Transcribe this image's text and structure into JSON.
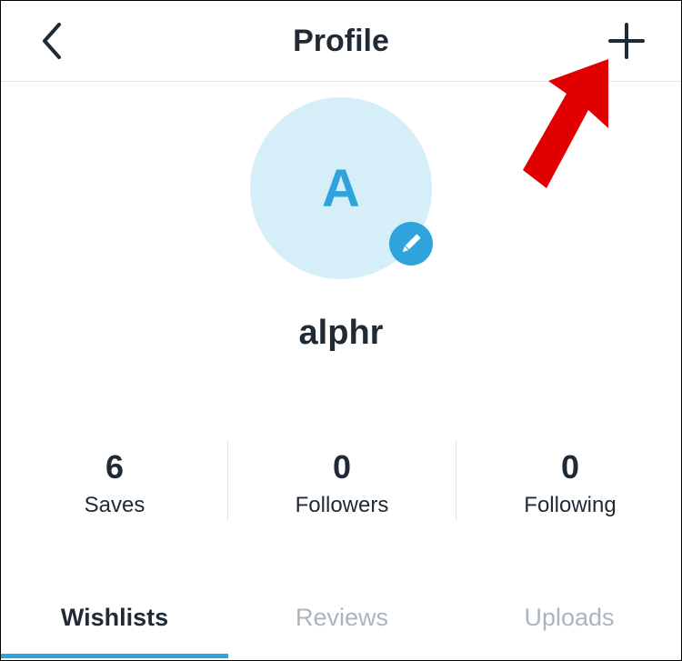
{
  "header": {
    "title": "Profile",
    "back_icon": "chevron-left-icon",
    "add_icon": "plus-icon"
  },
  "profile": {
    "initial": "A",
    "username": "alphr",
    "edit_icon": "pencil-icon"
  },
  "stats": [
    {
      "value": "6",
      "label": "Saves"
    },
    {
      "value": "0",
      "label": "Followers"
    },
    {
      "value": "0",
      "label": "Following"
    }
  ],
  "tabs": [
    {
      "label": "Wishlists",
      "active": true
    },
    {
      "label": "Reviews",
      "active": false
    },
    {
      "label": "Uploads",
      "active": false
    }
  ],
  "colors": {
    "accent": "#2ea3dc",
    "avatar_bg": "#d6eef8",
    "text": "#1f2a35",
    "muted": "#a9b6be",
    "annotation_arrow": "#e00000"
  }
}
